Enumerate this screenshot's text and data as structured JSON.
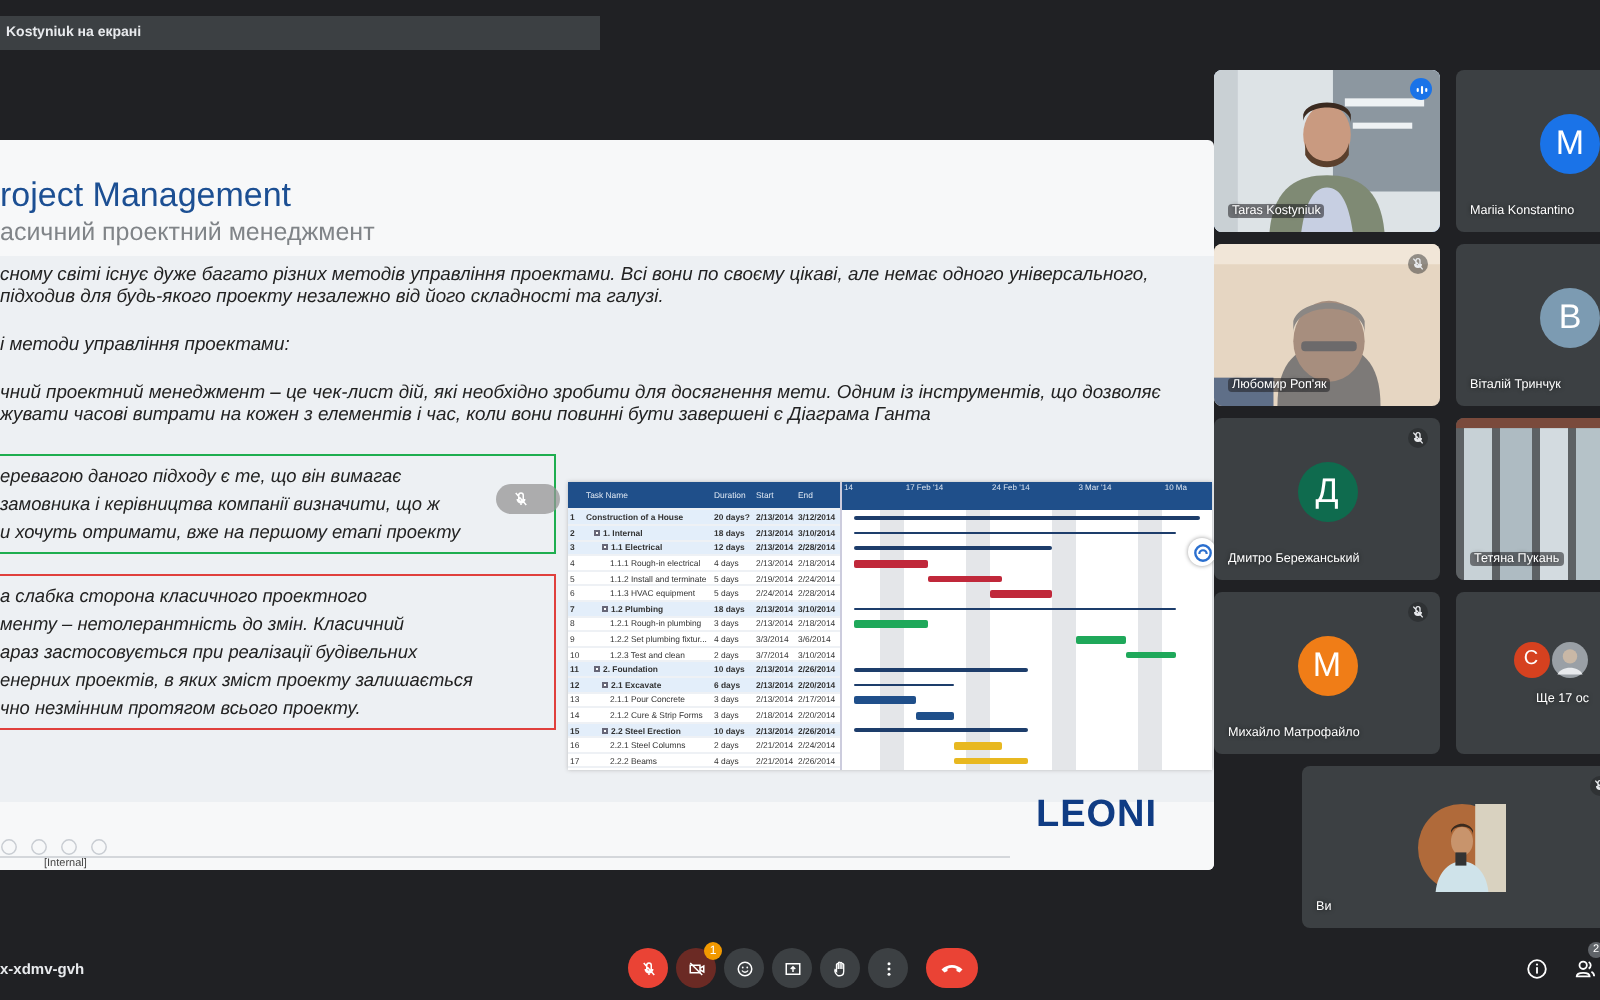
{
  "presenter_banner": "Kostyniuk на екрані",
  "slide": {
    "title": "roject Management",
    "subtitle": "асичний проектний менеджмент",
    "paragraphs": [
      [
        "сному світі існує дуже багато різних методів управління проектами. Всі вони по своєму цікаві, але немає одного універсального,",
        "підходив для будь-якого проекту незалежно від його складності та галузі."
      ],
      [
        "і методи управління проектами:"
      ],
      [
        "чний проектний менеджмент – це чек-лист дій, які необхідно зробити для досягнення мети. Одним із інструментів, що дозволяє",
        "жувати часові витрати на кожен з елементів і час, коли вони повинні бути завершені є Діаграма Ганта"
      ]
    ],
    "boxes": [
      {
        "kind": "pro",
        "lines": [
          "еревагою даного підходу є те, що він вимагає",
          "замовника і керівництва компанії визначити, що ж",
          "и хочуть отримати, вже на першому етапі проекту"
        ]
      },
      {
        "kind": "con",
        "lines": [
          "а слабка сторона класичного проектного",
          "менту – нетолерантність до змін. Класичний",
          "араз застосовується при реалізації будівельних",
          "енерних проектів, в яких зміст проекту залишається",
          "чно незмінним протягом всього проекту."
        ]
      }
    ],
    "gantt": {
      "columns": [
        "Task Name",
        "Duration",
        "Start",
        "End"
      ],
      "weeks": [
        "14",
        "17 Feb '14",
        "24 Feb '14",
        "3 Mar '14",
        "10 Ma"
      ],
      "rows": [
        {
          "num": "1",
          "name": "Construction of a House",
          "duration": "20 days?",
          "start": "2/13/2014",
          "end": "3/12/2014",
          "children": [
            {
              "num": "2",
              "name": "1. Internal",
              "duration": "18 days",
              "start": "2/13/2014",
              "end": "3/10/2014",
              "expanded": true,
              "children": [
                {
                  "num": "3",
                  "name": "1.1 Electrical",
                  "duration": "12 days",
                  "start": "2/13/2014",
                  "end": "2/28/2014",
                  "expanded": true,
                  "children": [
                    {
                      "num": "4",
                      "name": "1.1.1 Rough-in electrical",
                      "duration": "4 days",
                      "start": "2/13/2014",
                      "end": "2/18/2014",
                      "color": "#c0283a"
                    },
                    {
                      "num": "5",
                      "name": "1.1.2 Install and terminate",
                      "duration": "5 days",
                      "start": "2/19/2014",
                      "end": "2/24/2014",
                      "color": "#c0283a"
                    },
                    {
                      "num": "6",
                      "name": "1.1.3 HVAC equipment",
                      "duration": "5 days",
                      "start": "2/24/2014",
                      "end": "2/28/2014",
                      "color": "#c0283a"
                    }
                  ]
                },
                {
                  "num": "7",
                  "name": "1.2 Plumbing",
                  "duration": "18 days",
                  "start": "2/13/2014",
                  "end": "3/10/2014",
                  "expanded": true,
                  "children": [
                    {
                      "num": "8",
                      "name": "1.2.1 Rough-in plumbing",
                      "duration": "3 days",
                      "start": "2/13/2014",
                      "end": "2/18/2014",
                      "color": "#1fa85a"
                    },
                    {
                      "num": "9",
                      "name": "1.2.2 Set plumbing fixtur...",
                      "duration": "4 days",
                      "start": "3/3/2014",
                      "end": "3/6/2014",
                      "color": "#1fa85a"
                    },
                    {
                      "num": "10",
                      "name": "1.2.3 Test and clean",
                      "duration": "2 days",
                      "start": "3/7/2014",
                      "end": "3/10/2014",
                      "color": "#1fa85a"
                    }
                  ]
                }
              ]
            },
            {
              "num": "11",
              "name": "2. Foundation",
              "duration": "10 days",
              "start": "2/13/2014",
              "end": "2/26/2014",
              "expanded": true,
              "children": [
                {
                  "num": "12",
                  "name": "2.1 Excavate",
                  "duration": "6 days",
                  "start": "2/13/2014",
                  "end": "2/20/2014",
                  "expanded": true,
                  "children": [
                    {
                      "num": "13",
                      "name": "2.1.1 Pour Concrete",
                      "duration": "3 days",
                      "start": "2/13/2014",
                      "end": "2/17/2014",
                      "color": "#1f4f8a"
                    },
                    {
                      "num": "14",
                      "name": "2.1.2 Cure & Strip Forms",
                      "duration": "3 days",
                      "start": "2/18/2014",
                      "end": "2/20/2014",
                      "color": "#1f4f8a"
                    }
                  ]
                },
                {
                  "num": "15",
                  "name": "2.2 Steel Erection",
                  "duration": "10 days",
                  "start": "2/13/2014",
                  "end": "2/26/2014",
                  "expanded": true,
                  "children": [
                    {
                      "num": "16",
                      "name": "2.2.1 Steel Columns",
                      "duration": "2 days",
                      "start": "2/21/2014",
                      "end": "2/24/2014",
                      "color": "#e8b820"
                    },
                    {
                      "num": "17",
                      "name": "2.2.2 Beams",
                      "duration": "4 days",
                      "start": "2/21/2014",
                      "end": "2/26/2014",
                      "color": "#e8b820"
                    }
                  ]
                }
              ]
            }
          ]
        }
      ]
    },
    "footer_tag": "[Internal]",
    "logo": "LEONI"
  },
  "tiles": [
    {
      "kind": "video",
      "name": "Taras Kostyniuk",
      "speaking": true,
      "muted": false
    },
    {
      "kind": "avatar",
      "name": "Mariia Konstantino",
      "initial": "M",
      "color": "#1a73e8",
      "speaking": false,
      "muted": false
    },
    {
      "kind": "video",
      "name": "Любомир Роп'як",
      "speaking": false,
      "muted": true
    },
    {
      "kind": "avatar",
      "name": "Віталій Тринчук",
      "initial": "В",
      "color": "#7c9bb2",
      "speaking": false,
      "muted": false
    },
    {
      "kind": "avatar",
      "name": "Дмитро Бережанський",
      "initial": "Д",
      "color": "#0f6b4e",
      "speaking": false,
      "muted": true
    },
    {
      "kind": "video",
      "name": "Тетяна Пукань",
      "speaking": false,
      "muted": false
    },
    {
      "kind": "avatar",
      "name": "Михайло Матрофайло",
      "initial": "М",
      "color": "#f07d17",
      "speaking": false,
      "muted": true
    },
    {
      "kind": "group",
      "name": "Ще 17 ос",
      "initial": "С",
      "color": "#d6411f",
      "speaking": false,
      "muted": false
    }
  ],
  "self_tile": {
    "name": "Ви",
    "muted": true
  },
  "meeting_code": "x-xdmv-gvh",
  "controls": [
    {
      "kind": "mic",
      "off": true
    },
    {
      "kind": "camera",
      "off": true,
      "badge": "1"
    },
    {
      "kind": "emoji",
      "off": false
    },
    {
      "kind": "present",
      "off": false
    },
    {
      "kind": "hand",
      "off": false
    },
    {
      "kind": "more",
      "off": false
    },
    {
      "kind": "end",
      "off": true
    }
  ],
  "people_badge": "2"
}
